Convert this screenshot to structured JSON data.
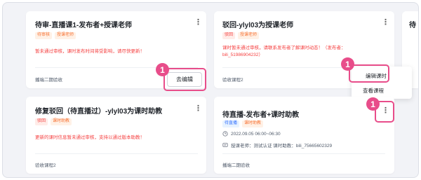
{
  "cards": [
    {
      "title": "待审-直播课1-发布者+授课老师",
      "tags": [
        "待审核",
        "授课老师"
      ],
      "warning": "暂未通过审核，课时发布时间将受影响，请尽快更新！",
      "footer": "播端二期验收",
      "edit_button": "去编辑"
    },
    {
      "title": "驳回-ylyl03为授课老师",
      "tags": [
        "驳回",
        "授课老师"
      ],
      "warning_line1": "课时暂未通过审核，请联系发布者了解课时动态！（发布者：",
      "warning_line2": "bili_51986904232）",
      "footer": "验收课程2"
    },
    {
      "title": "修复驳回（待直播过）-ylyl03为课时助教",
      "tags": [
        "驳回",
        "课时助教"
      ],
      "warning": "更新的课时信息暂未通过审核，支持以通过版本助教！",
      "footer": "验收课程2"
    },
    {
      "title": "待直播-发布者+课时助教",
      "tags": [
        "待直播",
        "课时助教"
      ],
      "time": "2022.09.05 06:00~06:30",
      "teacher": "授课老师：测试认证   课时助教：bili_75665602329",
      "footer": "播端二期验收"
    },
    {
      "title": "待"
    }
  ],
  "dropdown": {
    "items": [
      "编辑课时",
      "查看课程"
    ]
  },
  "badges": [
    "1",
    "1",
    "1"
  ],
  "more_glyph": "⋮"
}
